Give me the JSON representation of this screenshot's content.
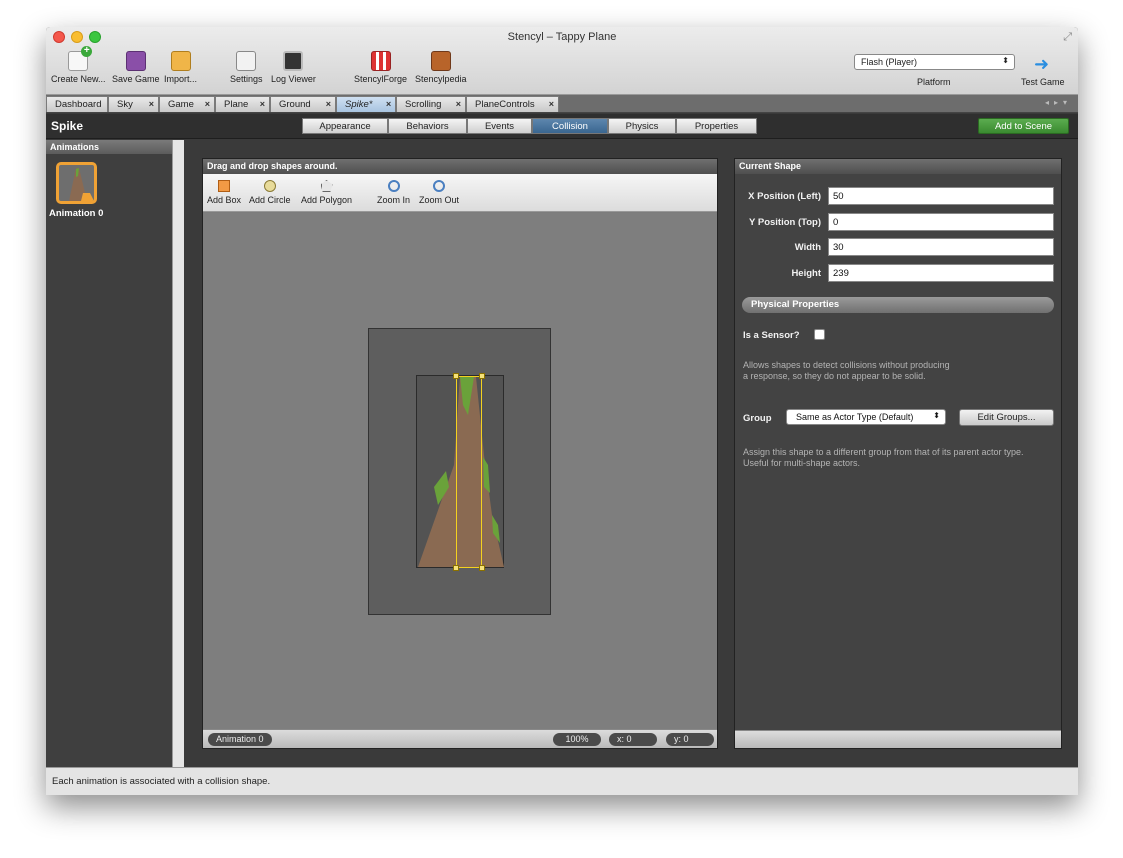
{
  "window": {
    "title": "Stencyl – Tappy Plane"
  },
  "toolbar": {
    "create_new": "Create New...",
    "save_game": "Save Game",
    "import": "Import...",
    "settings": "Settings",
    "log_viewer": "Log Viewer",
    "stencylforge": "StencylForge",
    "stencylpedia": "Stencylpedia",
    "platform_value": "Flash (Player)",
    "platform_label": "Platform",
    "test_game": "Test Game"
  },
  "tabs": [
    {
      "label": "Dashboard"
    },
    {
      "label": "Sky"
    },
    {
      "label": "Game"
    },
    {
      "label": "Plane"
    },
    {
      "label": "Ground"
    },
    {
      "label": "Spike*"
    },
    {
      "label": "Scrolling"
    },
    {
      "label": "PlaneControls"
    }
  ],
  "header": {
    "title": "Spike",
    "segments": [
      "Appearance",
      "Behaviors",
      "Events",
      "Collision",
      "Physics",
      "Properties"
    ],
    "active_segment": "Collision",
    "add_to_scene": "Add to Scene"
  },
  "animations": {
    "header": "Animations",
    "items": [
      {
        "label": "Animation 0"
      }
    ]
  },
  "editor": {
    "header": "Drag and drop shapes around.",
    "tools": {
      "add_box": "Add Box",
      "add_circle": "Add Circle",
      "add_polygon": "Add Polygon",
      "zoom_in": "Zoom In",
      "zoom_out": "Zoom Out"
    },
    "status": {
      "animation": "Animation 0",
      "zoom": "100%",
      "x": "x:   0",
      "y": "y:   0"
    }
  },
  "current_shape": {
    "header": "Current Shape",
    "x_label": "X Position (Left)",
    "x_value": "50",
    "y_label": "Y Position (Top)",
    "y_value": "0",
    "width_label": "Width",
    "width_value": "30",
    "height_label": "Height",
    "height_value": "239",
    "physical_properties": "Physical Properties",
    "sensor_label": "Is a Sensor?",
    "sensor_help_1": "Allows shapes to detect collisions without producing",
    "sensor_help_2": "a response, so they do not appear to be solid.",
    "group_label": "Group",
    "group_value": "Same as Actor Type (Default)",
    "edit_groups": "Edit Groups...",
    "group_help_1": "Assign this shape to a different group from that of its parent actor type.",
    "group_help_2": "Useful for multi-shape actors."
  },
  "statusbar": {
    "text": "Each animation is associated with a collision shape."
  },
  "colors": {
    "accent": "#3a6690",
    "add_scene": "#4a9c3f",
    "selection": "#f4d21f",
    "thumb_border": "#f0a235"
  }
}
